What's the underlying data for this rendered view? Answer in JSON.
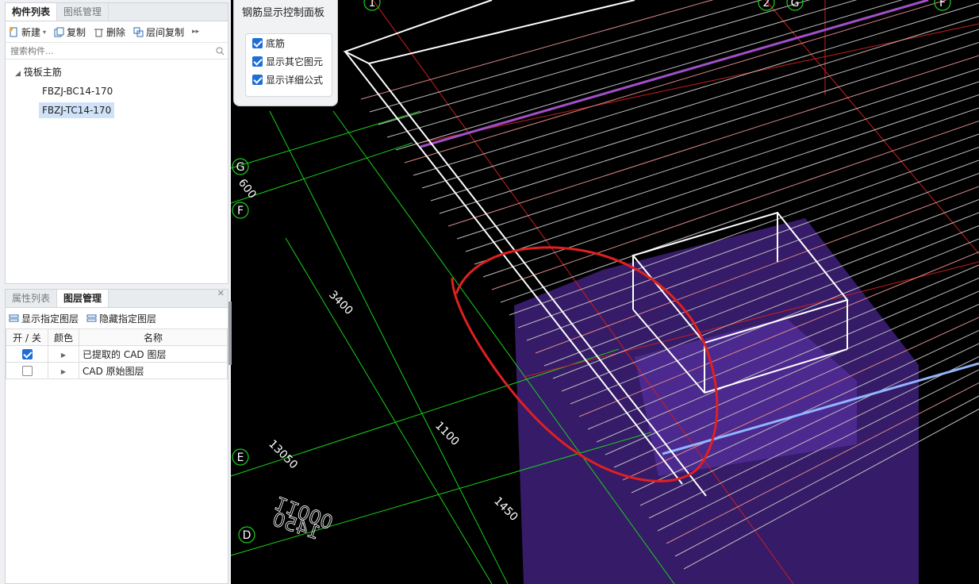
{
  "component_panel": {
    "tabs": [
      "构件列表",
      "图纸管理"
    ],
    "toolbar": {
      "new": "新建",
      "copy": "复制",
      "delete": "删除",
      "floor_copy": "层间复制"
    },
    "search_placeholder": "搜索构件...",
    "tree": {
      "root": "筏板主筋",
      "items": [
        "FBZJ-BC14-170",
        "FBZJ-TC14-170"
      ]
    }
  },
  "layer_panel": {
    "tabs": [
      "属性列表",
      "图层管理"
    ],
    "toolbar": {
      "show": "显示指定图层",
      "hide": "隐藏指定图层"
    },
    "columns": [
      "开 / 关",
      "颜色",
      "名称"
    ],
    "rows": [
      {
        "checked": true,
        "name": "已提取的 CAD 图层"
      },
      {
        "checked": false,
        "name": "CAD 原始图层"
      }
    ]
  },
  "control_panel": {
    "title": "钢筋显示控制面板",
    "options": [
      {
        "label": "底筋",
        "checked": true
      },
      {
        "label": "显示其它图元",
        "checked": true
      },
      {
        "label": "显示详细公式",
        "checked": true
      }
    ]
  },
  "viewport": {
    "axis_labels": [
      "1",
      "2",
      "G",
      "F",
      "G",
      "F",
      "E",
      "D"
    ],
    "dimensions": [
      "600",
      "3400",
      "1100",
      "1450",
      "13050"
    ],
    "mirrored_texts": [
      "11000",
      "1450"
    ]
  },
  "colors": {
    "accent": "#1d6fd6",
    "grid": "#19d119",
    "highlight": "#e02020"
  }
}
